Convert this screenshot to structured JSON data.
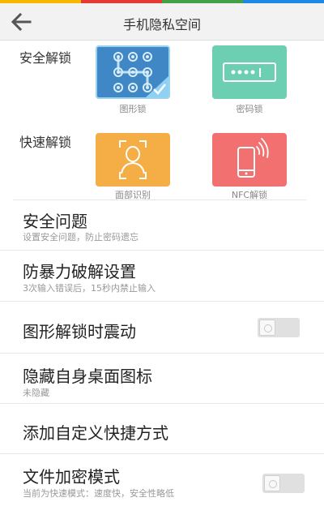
{
  "header": {
    "title": "手机隐私空间",
    "back_icon": "back-arrow-icon",
    "stripe_colors": [
      "#f6b800",
      "#e53935",
      "#43a047",
      "#1e88e5"
    ]
  },
  "secure_unlock": {
    "label": "安全解锁",
    "options": [
      {
        "name": "pattern",
        "label": "图形锁",
        "icon": "pattern-grid-icon",
        "color": "#3f88c5",
        "selected": true
      },
      {
        "name": "password",
        "label": "密码锁",
        "icon": "password-field-icon",
        "color": "#6dcfb1",
        "selected": false
      }
    ]
  },
  "quick_unlock": {
    "label": "快速解锁",
    "options": [
      {
        "name": "face",
        "label": "面部识别",
        "icon": "face-scan-icon",
        "color": "#f5ad46"
      },
      {
        "name": "nfc",
        "label": "NFC解锁",
        "icon": "phone-nfc-icon",
        "color": "#f27070"
      }
    ]
  },
  "settings": [
    {
      "title": "安全问题",
      "subtitle": "设置安全问题，防止密码遗忘"
    },
    {
      "title": "防暴力破解设置",
      "subtitle": "3次输入错误后，15秒内禁止输入"
    },
    {
      "title": "图形解锁时震动",
      "toggle": "off"
    },
    {
      "title": "隐藏自身桌面图标",
      "subtitle": "未隐藏"
    },
    {
      "title": "添加自定义快捷方式"
    },
    {
      "title": "文件加密模式",
      "subtitle": "当前为快速模式：速度快，安全性略低",
      "toggle": "off"
    }
  ]
}
